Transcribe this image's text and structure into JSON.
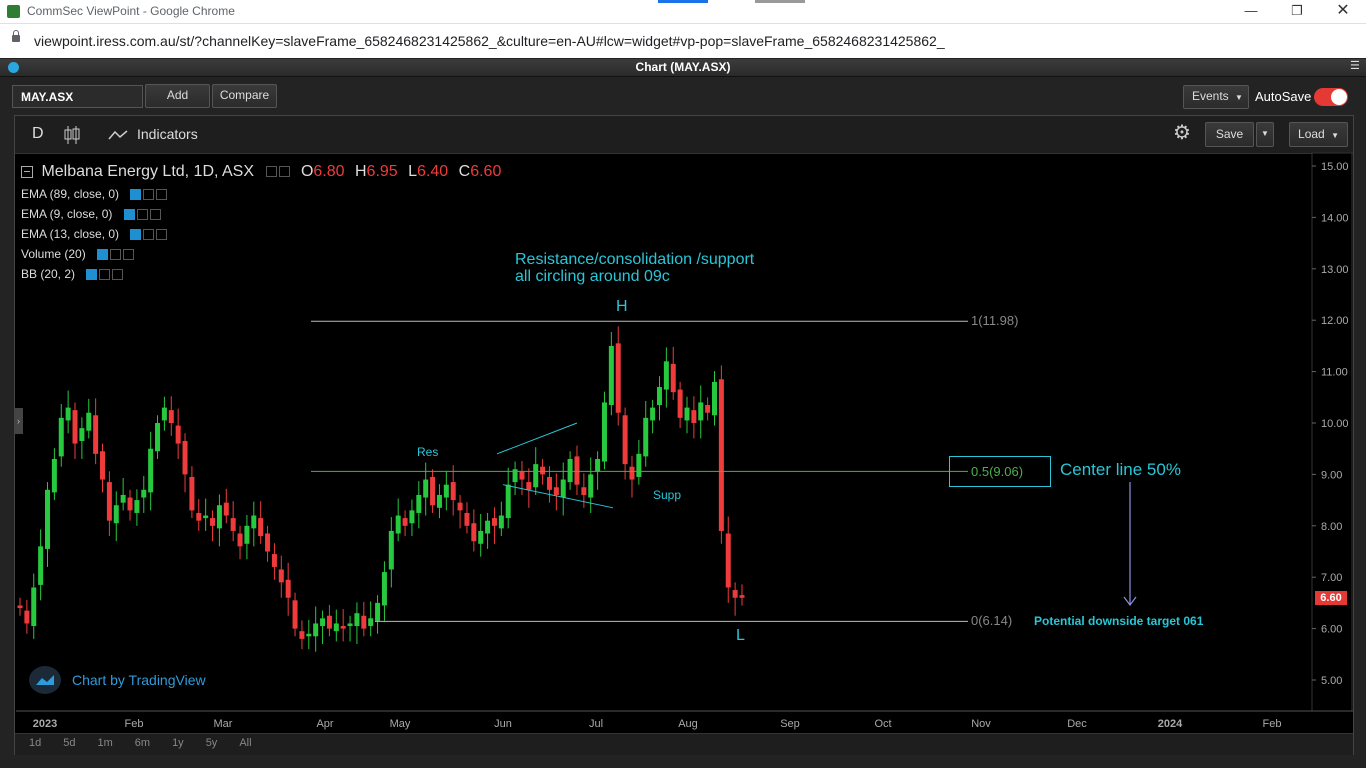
{
  "browser": {
    "window_title": "CommSec ViewPoint - Google Chrome",
    "url": "viewpoint.iress.com.au/st/?channelKey=slaveFrame_6582468231425862_&culture=en-AU#lcw=widget#vp-pop=slaveFrame_6582468231425862_"
  },
  "widget": {
    "title": "Chart (MAY.ASX)",
    "symbol": "MAY.ASX",
    "add_label": "Add",
    "compare_label": "Compare",
    "events_label": "Events",
    "autosave_label": "AutoSave",
    "autosave_on": true
  },
  "toolbar": {
    "interval": "D",
    "indicators_label": "Indicators",
    "save_label": "Save",
    "load_label": "Load"
  },
  "legend": {
    "title": "Melbana Energy Ltd, 1D, ASX",
    "o_label": "O",
    "o_value": "6.80",
    "h_label": "H",
    "h_value": "6.95",
    "l_label": "L",
    "l_value": "6.40",
    "c_label": "C",
    "c_value": "6.60",
    "indicators": [
      "EMA (89, close, 0)",
      "EMA (9, close, 0)",
      "EMA (13, close, 0)",
      "Volume (20)",
      "BB (20, 2)"
    ]
  },
  "annotations": {
    "note_line1": "Resistance/consolidation /support",
    "note_line2": "all circling around 09c",
    "high_marker": "H",
    "low_marker": "L",
    "res_label": "Res",
    "supp_label": "Supp",
    "fib_top": "1(11.98)",
    "fib_mid": "0.5(9.06)",
    "fib_bottom": "0(6.14)",
    "center_line": "Center line 50%",
    "target": "Potential downside target 061",
    "watermark": "Chart by TradingView"
  },
  "ranges": [
    "1d",
    "5d",
    "1m",
    "6m",
    "1y",
    "5y",
    "All"
  ],
  "colors": {
    "up": "#26a69a",
    "up_bright": "#27c93f",
    "down": "#ef3b3b",
    "accent": "#29c6d8",
    "fib_mid": "#4caf50"
  },
  "chart_data": {
    "type": "candlestick",
    "symbol": "MAY.ASX",
    "price_axis_ticks": [
      "15.00",
      "14.00",
      "13.00",
      "12.00",
      "11.00",
      "10.00",
      "9.00",
      "8.00",
      "7.00",
      "6.00",
      "5.00"
    ],
    "ylim": [
      4.5,
      15.2
    ],
    "time_axis_ticks": [
      "2023",
      "Feb",
      "Mar",
      "Apr",
      "May",
      "Jun",
      "Jul",
      "Aug",
      "Sep",
      "Oct",
      "Nov",
      "Dec",
      "2024",
      "Feb"
    ],
    "last_price": "6.60",
    "fib_levels": [
      {
        "level": 1,
        "price": 11.98
      },
      {
        "level": 0.5,
        "price": 9.06
      },
      {
        "level": 0,
        "price": 6.14
      }
    ],
    "closes": [
      6.4,
      6.1,
      6.8,
      7.6,
      8.7,
      9.3,
      10.1,
      10.3,
      9.6,
      9.9,
      10.2,
      9.4,
      8.9,
      8.1,
      8.4,
      8.6,
      8.3,
      8.5,
      8.7,
      9.5,
      10.0,
      10.3,
      10.0,
      9.6,
      9.0,
      8.3,
      8.1,
      8.2,
      8.0,
      8.4,
      8.2,
      7.9,
      7.6,
      8.0,
      8.2,
      7.8,
      7.5,
      7.2,
      6.9,
      6.6,
      6.0,
      5.8,
      5.9,
      6.1,
      6.2,
      6.0,
      6.1,
      6.0,
      6.1,
      6.3,
      6.0,
      6.2,
      6.5,
      7.1,
      7.9,
      8.2,
      8.0,
      8.3,
      8.6,
      8.9,
      8.4,
      8.6,
      8.8,
      8.5,
      8.3,
      8.0,
      7.7,
      7.9,
      8.1,
      8.0,
      8.2,
      8.8,
      9.1,
      8.9,
      8.7,
      9.2,
      9.0,
      8.7,
      8.6,
      8.9,
      9.3,
      8.8,
      8.6,
      9.0,
      9.3,
      10.4,
      11.5,
      10.2,
      9.2,
      8.9,
      9.4,
      10.1,
      10.3,
      10.7,
      11.2,
      10.6,
      10.1,
      10.3,
      10.0,
      10.4,
      10.2,
      10.8,
      7.9,
      6.8,
      6.6,
      6.6
    ]
  }
}
